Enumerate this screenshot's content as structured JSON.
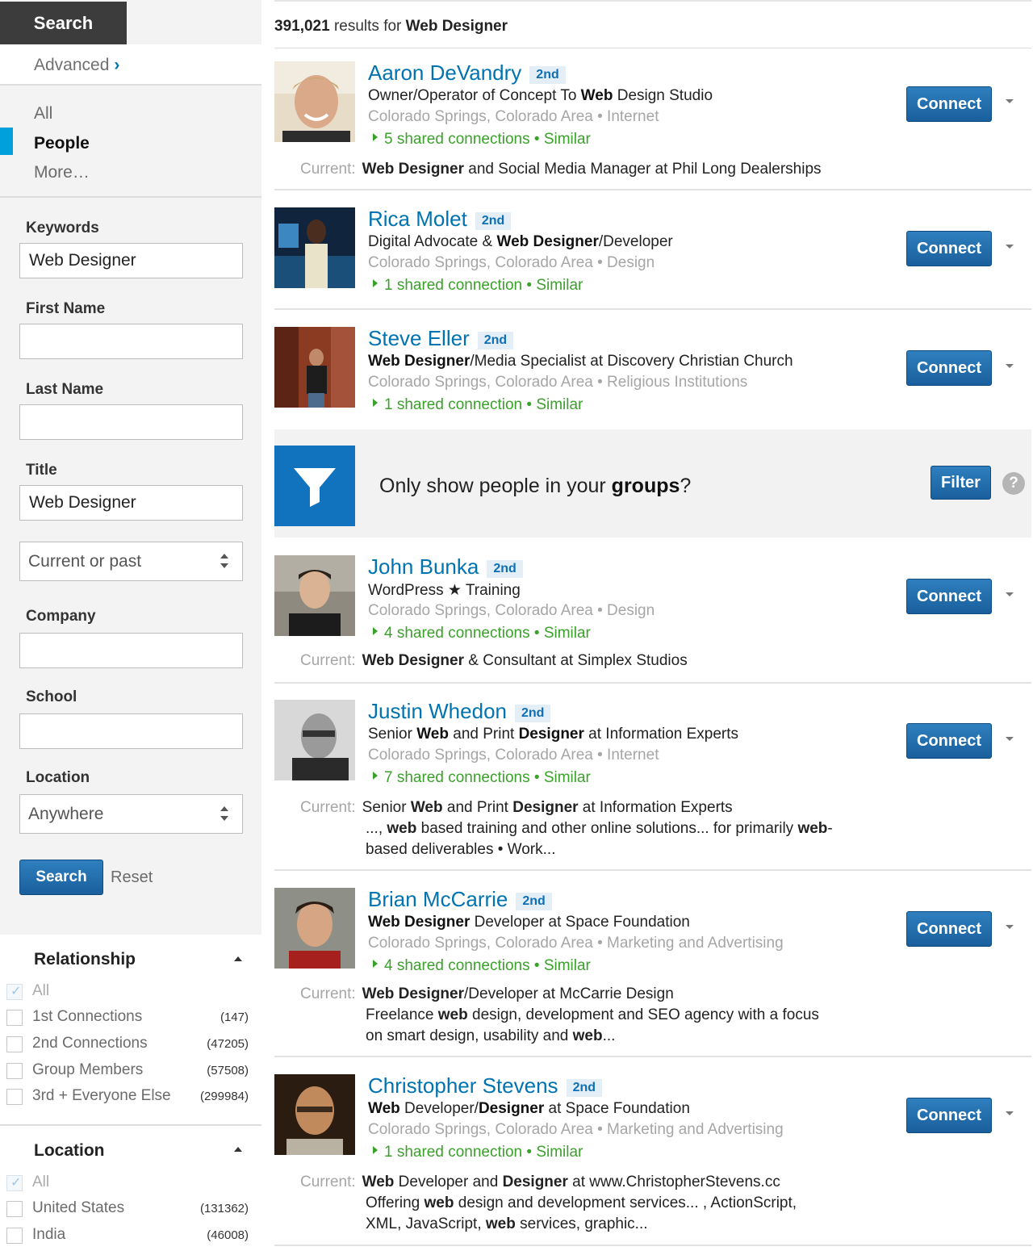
{
  "sidebar": {
    "search_tab": "Search",
    "advanced": "Advanced",
    "advanced_chevron": "›",
    "nav": {
      "all": "All",
      "people": "People",
      "more": "More…"
    },
    "keywords": {
      "label": "Keywords",
      "value": "Web Designer"
    },
    "first_name": {
      "label": "First Name",
      "value": ""
    },
    "last_name": {
      "label": "Last Name",
      "value": ""
    },
    "title": {
      "label": "Title",
      "value": "Web Designer"
    },
    "title_scope": "Current or past",
    "company": {
      "label": "Company",
      "value": ""
    },
    "school": {
      "label": "School",
      "value": ""
    },
    "location": {
      "label": "Location",
      "value": "Anywhere"
    },
    "search_button": "Search",
    "reset": "Reset",
    "relationship": {
      "title": "Relationship",
      "items": [
        {
          "label": "All",
          "count": "",
          "checked": true
        },
        {
          "label": "1st Connections",
          "count": "(147)",
          "checked": false
        },
        {
          "label": "2nd Connections",
          "count": "(47205)",
          "checked": false
        },
        {
          "label": "Group Members",
          "count": "(57508)",
          "checked": false
        },
        {
          "label": "3rd + Everyone Else",
          "count": "(299984)",
          "checked": false
        }
      ]
    },
    "location_facet": {
      "title": "Location",
      "items": [
        {
          "label": "All",
          "count": "",
          "checked": true
        },
        {
          "label": "United States",
          "count": "(131362)",
          "checked": false
        },
        {
          "label": "India",
          "count": "(46008)",
          "checked": false
        }
      ]
    }
  },
  "header": {
    "count": "391,021",
    "results_for": "results for",
    "query": "Web Designer"
  },
  "colors": {
    "accent": "#0073b1",
    "connect": "#1a5f9d",
    "shared": "#3aa12a",
    "active_bar": "#00a0dc"
  },
  "results": [
    {
      "name": "Aaron DeVandry",
      "degree": "2nd",
      "location": "Colorado Springs, Colorado Area • Internet",
      "shared": "5 shared connections • Similar"
    },
    {
      "name": "Rica Molet",
      "degree": "2nd",
      "location": "Colorado Springs, Colorado Area • Design",
      "shared": "1 shared connection • Similar"
    },
    {
      "name": "Steve Eller",
      "degree": "2nd",
      "location": "Colorado Springs, Colorado Area • Religious Institutions",
      "shared": "1 shared connection • Similar"
    },
    {
      "name": "John Bunka",
      "degree": "2nd",
      "headline": "WordPress ★ Training",
      "location": "Colorado Springs, Colorado Area • Design",
      "shared": "4 shared connections • Similar"
    },
    {
      "name": "Justin Whedon",
      "degree": "2nd",
      "location": "Colorado Springs, Colorado Area • Internet",
      "shared": "7 shared connections • Similar"
    },
    {
      "name": "Brian McCarrie",
      "degree": "2nd",
      "location": "Colorado Springs, Colorado Area • Marketing and Advertising",
      "shared": "4 shared connections • Similar"
    },
    {
      "name": "Christopher Stevens",
      "degree": "2nd",
      "location": "Colorado Springs, Colorado Area • Marketing and Advertising",
      "shared": "1 shared connection • Similar"
    }
  ],
  "rich": {
    "r0_headline": [
      "Owner/Operator of Concept To ",
      "Web",
      " Design Studio"
    ],
    "r0_current": [
      "Web Designer",
      " and Social Media Manager at Phil Long Dealerships"
    ],
    "r1_headline": [
      "Digital Advocate & ",
      "Web Designer",
      "/Developer"
    ],
    "r2_headline": [
      "Web Designer",
      "/Media Specialist at Discovery Christian Church"
    ],
    "r3_current": [
      "Web Designer",
      " & Consultant at Simplex Studios"
    ],
    "r4_headline": [
      "Senior ",
      "Web",
      " and Print ",
      "Designer",
      " at Information Experts"
    ],
    "r4_current": [
      "Senior ",
      "Web",
      " and Print ",
      "Designer",
      " at Information Experts"
    ],
    "r4_snip1": [
      "..., ",
      "web",
      " based training and other online solutions... for primarily ",
      "web",
      "-"
    ],
    "r4_snip2": [
      "based deliverables • Work..."
    ],
    "r5_headline": [
      "Web Designer",
      " Developer at Space Foundation"
    ],
    "r5_current": [
      "Web Designer",
      "/Developer at McCarrie Design"
    ],
    "r5_snip1": [
      "Freelance ",
      "web",
      " design, development and SEO agency with a focus"
    ],
    "r5_snip2": [
      "on smart design, usability and ",
      "web",
      "..."
    ],
    "r6_headline": [
      "Web",
      " Developer/",
      "Designer",
      " at Space Foundation"
    ],
    "r6_current": [
      "Web",
      " Developer and ",
      "Designer",
      " at www.ChristopherStevens.cc"
    ],
    "r6_snip1": [
      "Offering ",
      "web",
      " design and development services... , ActionScript,"
    ],
    "r6_snip2": [
      "XML, JavaScript, ",
      "web",
      " services, graphic..."
    ]
  },
  "current_label": "Current:",
  "connect_label": "Connect",
  "groups_banner": {
    "question_prefix": "Only show people in your ",
    "question_bold": "groups",
    "question_suffix": "?",
    "filter_button": "Filter",
    "help": "?"
  }
}
